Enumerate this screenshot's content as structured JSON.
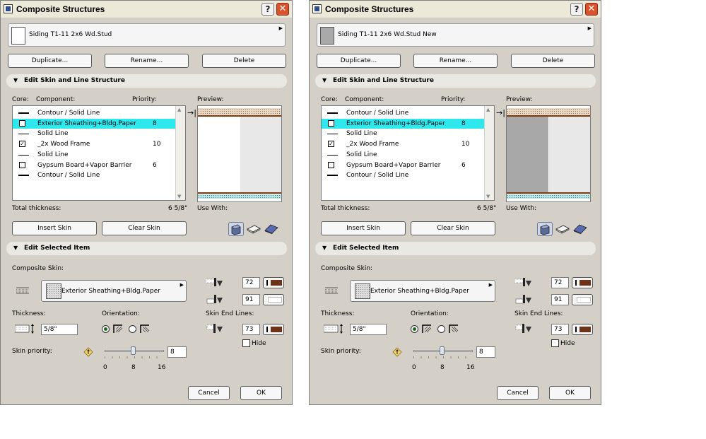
{
  "dialogs": [
    {
      "title": "Composite Structures",
      "help_label": "?",
      "close_label": "✕",
      "structure_name": "Siding T1-11 2x6 Wd.Stud",
      "buttons": {
        "duplicate": "Duplicate...",
        "rename": "Rename...",
        "delete": "Delete"
      },
      "section_skin": "Edit Skin and Line Structure",
      "headers": {
        "core": "Core:",
        "component": "Component:",
        "priority": "Priority:",
        "preview": "Preview:"
      },
      "rows": [
        {
          "kind": "line-thick",
          "name": "Contour /  Solid Line",
          "priority": ""
        },
        {
          "kind": "check",
          "checked": false,
          "highlighted": true,
          "name": "Exterior Sheathing+Bldg.Paper",
          "priority": "8"
        },
        {
          "kind": "line-thin",
          "name": "Solid Line",
          "priority": ""
        },
        {
          "kind": "check",
          "checked": true,
          "name": "_2x Wood Frame",
          "priority": "10"
        },
        {
          "kind": "line-thin",
          "name": "Solid Line",
          "priority": ""
        },
        {
          "kind": "check",
          "checked": false,
          "name": "Gypsum Board+Vapor Barrier",
          "priority": "6"
        },
        {
          "kind": "line-thick",
          "name": "Contour /  Solid Line",
          "priority": ""
        }
      ],
      "check_mark": "✓",
      "total_label": "Total thickness:",
      "total_value": "6 5/8\"",
      "use_with_label": "Use With:",
      "insert_skin": "Insert Skin",
      "clear_skin": "Clear Skin",
      "section_item": "Edit Selected Item",
      "composite_skin_label": "Composite Skin:",
      "skin_name": "Exterior Sheathing+Bldg.Paper",
      "thickness_label": "Thickness:",
      "thickness_value": "5/8\"",
      "orientation_label": "Orientation:",
      "pen_top": "72",
      "pen_bg": "91",
      "skin_end_lines_label": "Skin End Lines:",
      "end_pen": "73",
      "hide_label": "Hide",
      "skin_priority_label": "Skin priority:",
      "priority_value": "8",
      "slider_value": 8,
      "scale": [
        "0",
        "8",
        "16"
      ],
      "cancel": "Cancel",
      "ok": "OK"
    },
    {
      "title": "Composite Structures",
      "help_label": "?",
      "close_label": "✕",
      "structure_name": "Siding T1-11 2x6 Wd.Stud New",
      "buttons": {
        "duplicate": "Duplicate...",
        "rename": "Rename...",
        "delete": "Delete"
      },
      "section_skin": "Edit Skin and Line Structure",
      "headers": {
        "core": "Core:",
        "component": "Component:",
        "priority": "Priority:",
        "preview": "Preview:"
      },
      "rows": [
        {
          "kind": "line-thick",
          "name": "Contour /  Solid Line",
          "priority": ""
        },
        {
          "kind": "check",
          "checked": false,
          "highlighted": true,
          "name": "Exterior Sheathing+Bldg.Paper",
          "priority": "8"
        },
        {
          "kind": "line-thin",
          "name": "Solid Line",
          "priority": ""
        },
        {
          "kind": "check",
          "checked": true,
          "name": "_2x Wood Frame",
          "priority": "10"
        },
        {
          "kind": "line-thin",
          "name": "Solid Line",
          "priority": ""
        },
        {
          "kind": "check",
          "checked": false,
          "name": "Gypsum Board+Vapor Barrier",
          "priority": "6"
        },
        {
          "kind": "line-thick",
          "name": "Contour /  Solid Line",
          "priority": ""
        }
      ],
      "check_mark": "✓",
      "total_label": "Total thickness:",
      "total_value": "6 5/8\"",
      "use_with_label": "Use With:",
      "insert_skin": "Insert Skin",
      "clear_skin": "Clear Skin",
      "section_item": "Edit Selected Item",
      "composite_skin_label": "Composite Skin:",
      "skin_name": "Exterior Sheathing+Bldg.Paper",
      "thickness_label": "Thickness:",
      "thickness_value": "5/8\"",
      "orientation_label": "Orientation:",
      "pen_top": "72",
      "pen_bg": "91",
      "skin_end_lines_label": "Skin End Lines:",
      "end_pen": "73",
      "hide_label": "Hide",
      "skin_priority_label": "Skin priority:",
      "priority_value": "8",
      "slider_value": 8,
      "scale": [
        "0",
        "8",
        "16"
      ],
      "cancel": "Cancel",
      "ok": "OK"
    }
  ],
  "colors": {
    "highlight": "#2fe8ee",
    "skin_brown": "#6b3418",
    "dialog_bg": "#d4d0c8",
    "close_red": "#d9532d"
  },
  "icons": [
    "app-icon",
    "help-icon",
    "close-icon",
    "wall-icon",
    "slab-icon",
    "roof-icon",
    "pen-icon",
    "fill-pattern-icon",
    "orientation-icon",
    "priority-icon",
    "skin-end-icon",
    "thickness-icon"
  ]
}
